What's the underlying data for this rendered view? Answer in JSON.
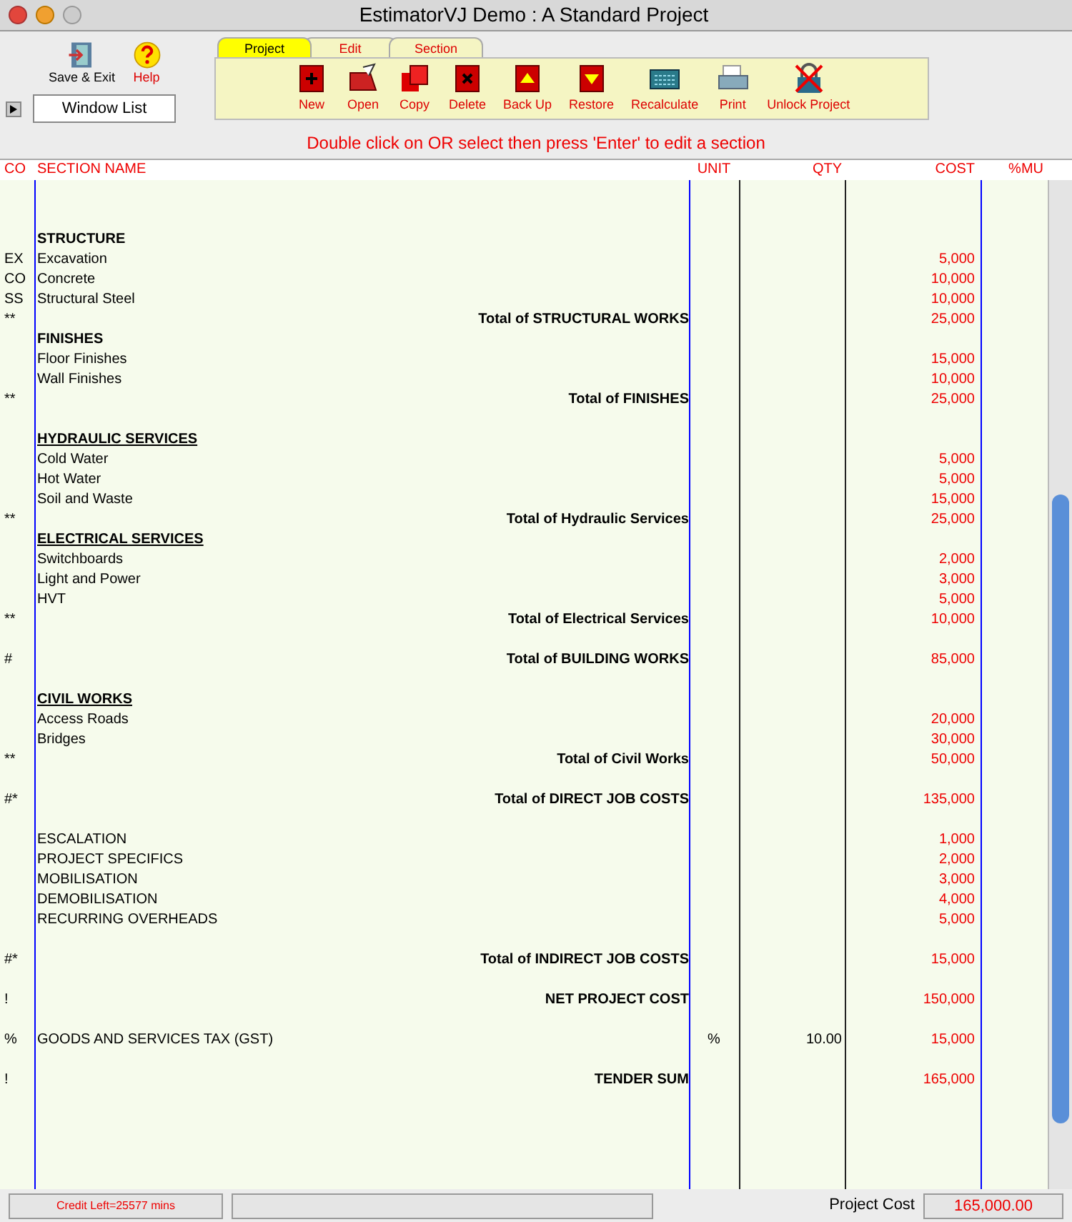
{
  "window": {
    "title": "EstimatorVJ Demo : A Standard Project"
  },
  "left_buttons": [
    {
      "label": "Save & Exit",
      "kind": "exit"
    },
    {
      "label": "Help",
      "kind": "help"
    }
  ],
  "window_list": "Window List",
  "tabs": [
    {
      "label": "Project",
      "selected": true
    },
    {
      "label": "Edit",
      "selected": false
    },
    {
      "label": "Section",
      "selected": false
    }
  ],
  "toolbar": [
    {
      "label": "New",
      "kind": "new"
    },
    {
      "label": "Open",
      "kind": "open"
    },
    {
      "label": "Copy",
      "kind": "copy"
    },
    {
      "label": "Delete",
      "kind": "delete"
    },
    {
      "label": "Back Up",
      "kind": "backup"
    },
    {
      "label": "Restore",
      "kind": "restore"
    },
    {
      "label": "Recalculate",
      "kind": "calc"
    },
    {
      "label": "Print",
      "kind": "print"
    },
    {
      "label": "Unlock Project",
      "kind": "unlock"
    }
  ],
  "hint": "Double click on OR select then press 'Enter' to edit a section",
  "table": {
    "columns": [
      "CO",
      "SECTION NAME",
      "UNIT",
      "QTY",
      "COST",
      "%MU"
    ],
    "rows": [
      {
        "kind": "heading",
        "name": "STRUCTURE",
        "underlined": false
      },
      {
        "kind": "item",
        "co": "EX",
        "name": "Excavation",
        "cost": "5,000"
      },
      {
        "kind": "item",
        "co": "CO",
        "name": "Concrete",
        "cost": "10,000"
      },
      {
        "kind": "item",
        "co": "SS",
        "name": "Structural Steel",
        "cost": "10,000"
      },
      {
        "kind": "total",
        "co": "**",
        "name": "Total of STRUCTURAL WORKS",
        "cost": "25,000"
      },
      {
        "kind": "heading",
        "name": "FINISHES",
        "underlined": false
      },
      {
        "kind": "item",
        "name": "Floor Finishes",
        "cost": "15,000"
      },
      {
        "kind": "item",
        "name": "Wall Finishes",
        "cost": "10,000"
      },
      {
        "kind": "total",
        "co": "**",
        "name": "Total of FINISHES",
        "cost": "25,000"
      },
      {
        "kind": "blank"
      },
      {
        "kind": "heading",
        "name": "HYDRAULIC SERVICES",
        "underlined": true
      },
      {
        "kind": "item",
        "name": "Cold Water",
        "cost": "5,000"
      },
      {
        "kind": "item",
        "name": "Hot Water",
        "cost": "5,000"
      },
      {
        "kind": "item",
        "name": "Soil and Waste",
        "cost": "15,000"
      },
      {
        "kind": "total",
        "co": "**",
        "name": "Total of Hydraulic Services",
        "cost": "25,000"
      },
      {
        "kind": "heading",
        "name": "ELECTRICAL SERVICES",
        "underlined": true
      },
      {
        "kind": "item",
        "name": "Switchboards",
        "cost": "2,000"
      },
      {
        "kind": "item",
        "name": "Light and Power",
        "cost": "3,000"
      },
      {
        "kind": "item",
        "name": "HVT",
        "cost": "5,000"
      },
      {
        "kind": "total",
        "co": "**",
        "name": "Total of Electrical Services",
        "cost": "10,000"
      },
      {
        "kind": "blank"
      },
      {
        "kind": "total",
        "co": "#",
        "name": "Total of BUILDING WORKS",
        "cost": "85,000"
      },
      {
        "kind": "blank"
      },
      {
        "kind": "heading",
        "name": "CIVIL WORKS",
        "underlined": true
      },
      {
        "kind": "item",
        "name": "Access Roads",
        "cost": "20,000"
      },
      {
        "kind": "item",
        "name": "Bridges",
        "cost": "30,000"
      },
      {
        "kind": "total",
        "co": "**",
        "name": "Total of Civil Works",
        "cost": "50,000"
      },
      {
        "kind": "blank"
      },
      {
        "kind": "total",
        "co": "#*",
        "name": "Total of DIRECT JOB COSTS",
        "cost": "135,000"
      },
      {
        "kind": "blank"
      },
      {
        "kind": "item",
        "name": "ESCALATION",
        "cost": "1,000"
      },
      {
        "kind": "item",
        "name": "PROJECT SPECIFICS",
        "cost": "2,000"
      },
      {
        "kind": "item",
        "name": "MOBILISATION",
        "cost": "3,000"
      },
      {
        "kind": "item",
        "name": "DEMOBILISATION",
        "cost": "4,000"
      },
      {
        "kind": "item",
        "name": "RECURRING OVERHEADS",
        "cost": "5,000"
      },
      {
        "kind": "blank"
      },
      {
        "kind": "total",
        "co": "#*",
        "name": "Total of INDIRECT JOB COSTS",
        "cost": "15,000"
      },
      {
        "kind": "blank"
      },
      {
        "kind": "total",
        "co": "!",
        "name": "NET PROJECT COST",
        "cost": "150,000"
      },
      {
        "kind": "blank"
      },
      {
        "kind": "item",
        "co": "%",
        "name": "GOODS AND SERVICES TAX (GST)",
        "unit": "%",
        "qty": "10.00",
        "cost": "15,000"
      },
      {
        "kind": "blank"
      },
      {
        "kind": "total",
        "co": "!",
        "name": "TENDER SUM",
        "cost": "165,000"
      }
    ]
  },
  "status_bar": {
    "credit": "Credit Left=25577 mins",
    "project_cost_label": "Project Cost",
    "project_cost": "165,000.00"
  }
}
